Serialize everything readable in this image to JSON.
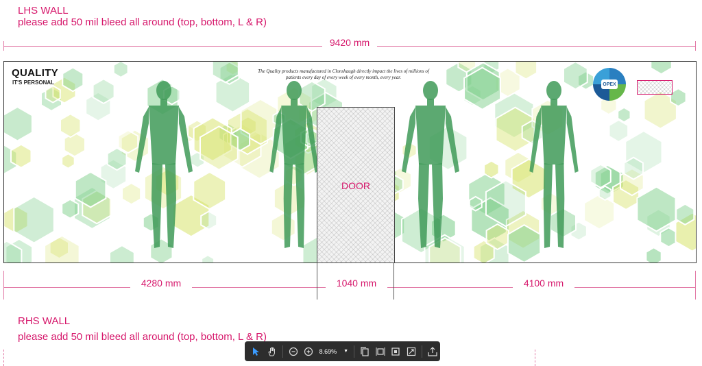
{
  "lhs": {
    "title": "LHS WALL",
    "note": "please add 50 mil bleed all around (top, bottom, L & R)"
  },
  "total_width": "9420 mm",
  "mural": {
    "brand_title": "QUALITY",
    "brand_subtitle": "IT'S PERSONAL",
    "tagline": "The Quality products manufactured in Clonshaugh directly impact the lives of millions of patients every day of every week of every month, every year.",
    "door_label": "DOOR",
    "logo_text": "OPEX"
  },
  "segments": {
    "left": "4280 mm",
    "door": "1040 mm",
    "right": "4100 mm"
  },
  "rhs": {
    "title": "RHS WALL",
    "note": "please add 50 mil bleed all around (top, bottom, L & R)"
  },
  "toolbar": {
    "zoom": "8.69%",
    "tools": [
      "select-tool",
      "hand-tool",
      "zoom-out",
      "zoom-in",
      "zoom-level",
      "page-view",
      "fit-width",
      "fit-page",
      "fullscreen",
      "share"
    ]
  },
  "colors": {
    "annotation": "#d6176b",
    "toolbar_bg": "#2d2d2d",
    "hex_green": "#7fcf8c",
    "hex_yellow": "#d7e36b",
    "figure_green": "#3f9a58"
  }
}
